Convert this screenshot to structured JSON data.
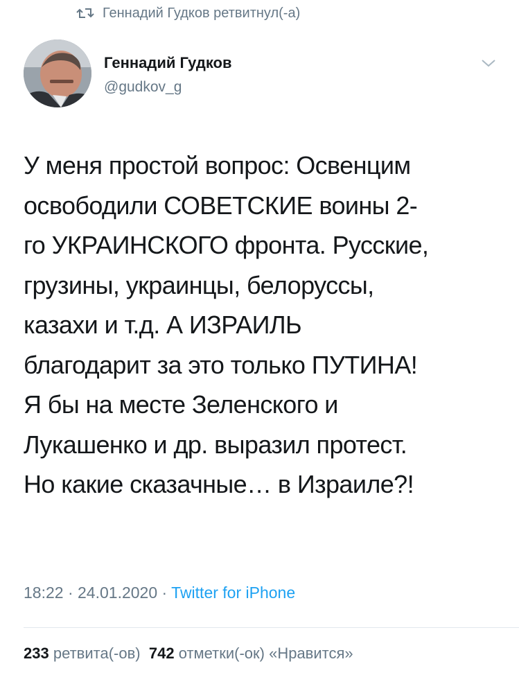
{
  "retweet": {
    "icon": "retweet-icon",
    "text": "Геннадий Гудков ретвитнул(-а)"
  },
  "author": {
    "avatar_icon": "avatar",
    "name": "Геннадий Гудков",
    "handle": "@gudkov_g",
    "menu_icon": "chevron-down-icon"
  },
  "tweet": {
    "lines": [
      "У меня простой вопрос: Освенцим",
      "освободили СОВЕТСКИЕ воины 2-",
      "го УКРАИНСКОГО фронта. Русские,",
      "грузины, украинцы, белоруссы,",
      "казахи и т.д. А ИЗРАИЛЬ",
      "благодарит за это только ПУТИНА!",
      "Я бы на месте Зеленского и",
      "Лукашенко и др. выразил протест.",
      "Но какие сказачные… в Израиле?!"
    ]
  },
  "meta": {
    "time": "18:22",
    "sep1": " · ",
    "date": "24.01.2020",
    "sep2": " · ",
    "source": "Twitter for iPhone"
  },
  "stats": {
    "retweets_count": "233",
    "retweets_label": "ретвита(-ов)",
    "likes_count": "742",
    "likes_label": "отметки(-ок) «Нравится»"
  },
  "colors": {
    "text": "#14171a",
    "secondary": "#657786",
    "link": "#1da1f2",
    "divider": "#e1e8ed"
  }
}
